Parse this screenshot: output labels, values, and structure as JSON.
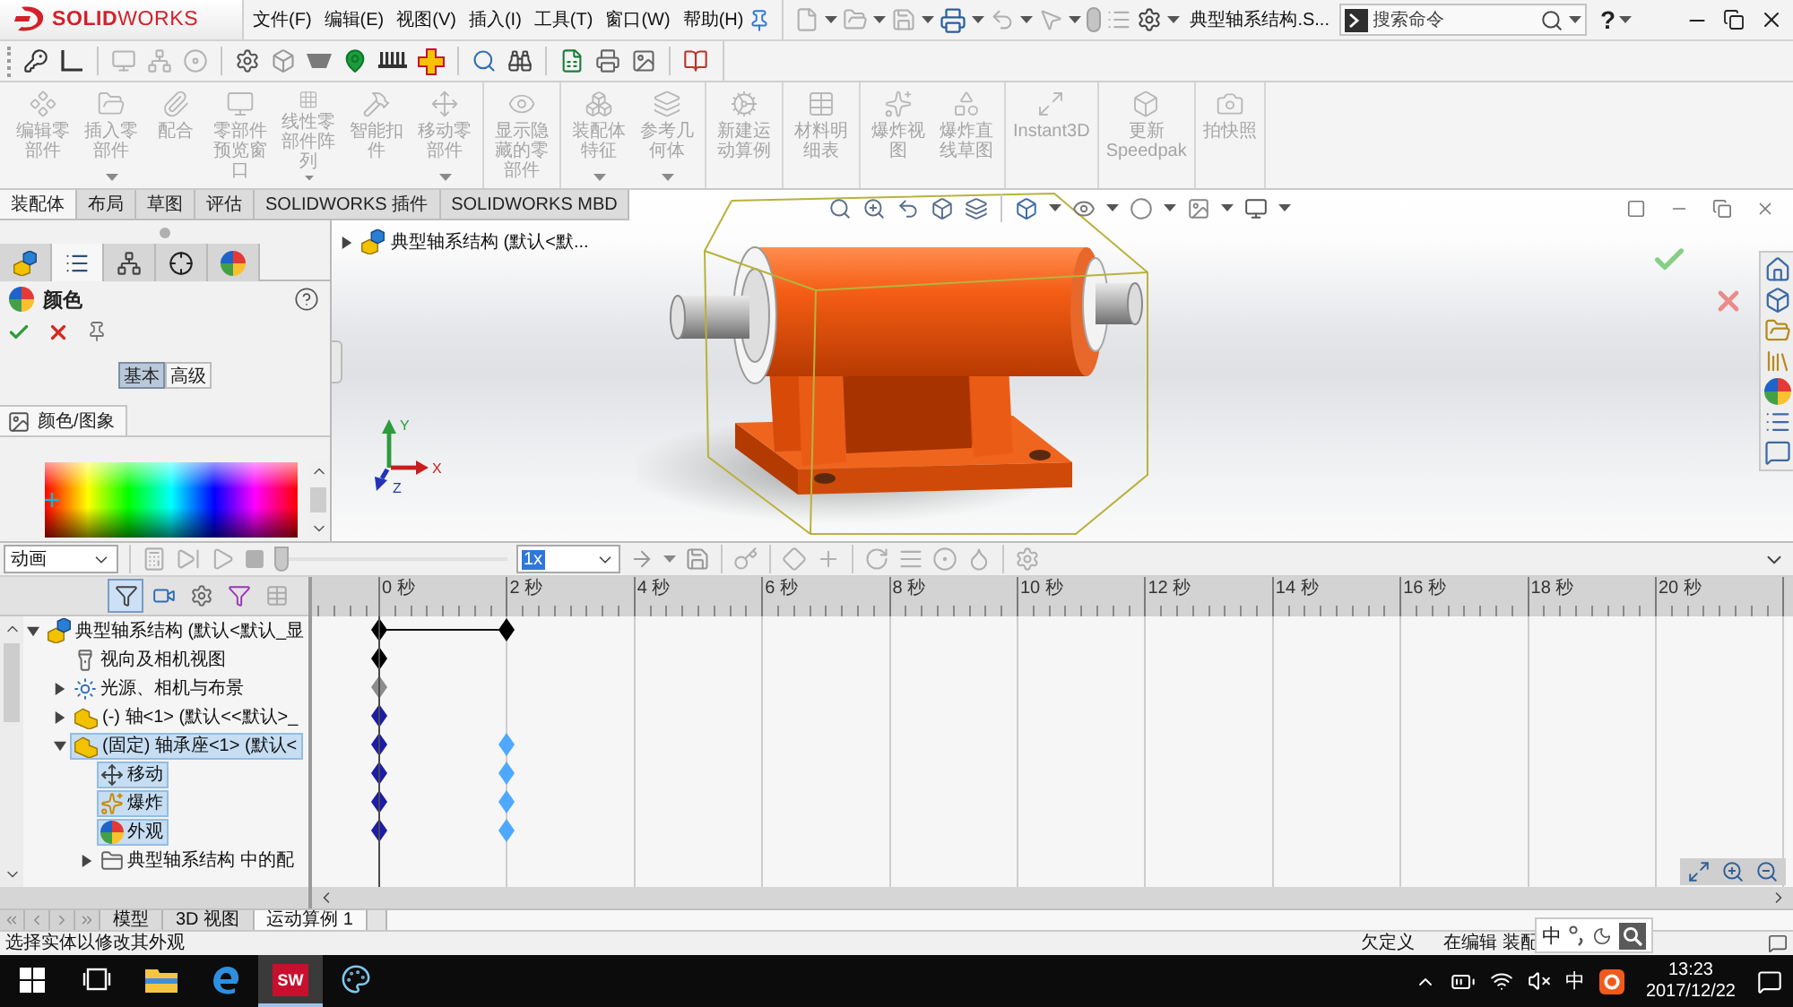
{
  "menubar": {
    "logo": "**SOLID**WORKS",
    "menus": [
      "文件(F)",
      "编辑(E)",
      "视图(V)",
      "插入(I)",
      "工具(T)",
      "窗口(W)",
      "帮助(H)"
    ],
    "document_title": "典型轴系结构.S...",
    "search": {
      "placeholder": "搜索命令"
    },
    "help": "?"
  },
  "ribbon": {
    "groups": [
      [
        {
          "label": "编辑零部件",
          "disabled": true,
          "dropdown": false
        },
        {
          "label": "插入零部件",
          "disabled": true,
          "dropdown": true
        },
        {
          "label": "配合",
          "disabled": true,
          "dropdown": false
        },
        {
          "label": "零部件预览窗口",
          "disabled": true,
          "dropdown": false
        },
        {
          "label": "线性零部件阵列",
          "disabled": true,
          "dropdown": true
        },
        {
          "label": "智能扣件",
          "disabled": true,
          "dropdown": false
        },
        {
          "label": "移动零部件",
          "disabled": true,
          "dropdown": true
        }
      ],
      [
        {
          "label": "显示隐藏的零部件",
          "disabled": true,
          "dropdown": false
        }
      ],
      [
        {
          "label": "装配体特征",
          "disabled": true,
          "dropdown": true
        },
        {
          "label": "参考几何体",
          "disabled": true,
          "dropdown": true
        }
      ],
      [
        {
          "label": "新建运动算例",
          "disabled": true,
          "dropdown": false
        }
      ],
      [
        {
          "label": "材料明细表",
          "disabled": true,
          "dropdown": false
        }
      ],
      [
        {
          "label": "爆炸视图",
          "disabled": true,
          "dropdown": false
        },
        {
          "label": "爆炸直线草图",
          "disabled": true,
          "dropdown": false
        }
      ],
      [
        {
          "label": "Instant3D",
          "disabled": true,
          "dropdown": false
        }
      ],
      [
        {
          "label": "更新 Speedpak",
          "disabled": true,
          "dropdown": false
        }
      ],
      [
        {
          "label": "拍快照",
          "disabled": true,
          "dropdown": false
        }
      ]
    ]
  },
  "tabs": [
    {
      "label": "装配体",
      "selected": true
    },
    {
      "label": "布局",
      "selected": false
    },
    {
      "label": "草图",
      "selected": false
    },
    {
      "label": "评估",
      "selected": false
    },
    {
      "label": "SOLIDWORKS 插件",
      "selected": false
    },
    {
      "label": "SOLIDWORKS MBD",
      "selected": false
    }
  ],
  "property_manager": {
    "tabs": [
      {
        "kind": "feature-tree",
        "selected": false
      },
      {
        "kind": "properties",
        "selected": true
      },
      {
        "kind": "configurations",
        "selected": false
      },
      {
        "kind": "dimxpert",
        "selected": false
      },
      {
        "kind": "display",
        "selected": false
      }
    ],
    "title": "颜色",
    "modes": [
      {
        "label": "基本",
        "selected": true
      },
      {
        "label": "高级",
        "selected": false
      }
    ],
    "section": "颜色/图象"
  },
  "viewport": {
    "tree_flyout": {
      "label": "典型轴系结构 (默认<默...",
      "expanded": false
    },
    "triad": [
      "X",
      "Y",
      "Z"
    ]
  },
  "motion_study": {
    "mode": "动画",
    "playback": {
      "level": 0
    },
    "speed": {
      "value": "1x",
      "highlighted": true
    },
    "filters": [
      {
        "kind": "funnel",
        "on": true
      },
      {
        "kind": "camera",
        "on": false
      },
      {
        "kind": "gear",
        "on": false
      },
      {
        "kind": "pointer",
        "on": false
      },
      {
        "kind": "table",
        "on": false
      }
    ],
    "tree": [
      {
        "kind": "assembly",
        "label": "典型轴系结构 (默认<默认_显",
        "expanded": true,
        "selected": false,
        "span": true,
        "start_key": {
          "color": "#000000"
        },
        "end_key": {
          "color": "#000000"
        },
        "children": [
          {
            "kind": "camera",
            "label": "视向及相机视图",
            "selected": false,
            "start_key": {
              "color": "#000000"
            }
          },
          {
            "kind": "lights",
            "label": "光源、相机与布景",
            "expanded": false,
            "selected": false,
            "start_key": {
              "color": "#8c8c8c"
            }
          },
          {
            "kind": "part",
            "label": "(-) 轴<1> (默认<<默认>_",
            "expanded": false,
            "selected": false,
            "start_key": {
              "color": "#1c1ca8"
            }
          },
          {
            "kind": "part",
            "label": "(固定) 轴承座<1> (默认<",
            "expanded": true,
            "selected": true,
            "span": false,
            "start_key": {
              "color": "#1c1ca8"
            },
            "end_key": {
              "color": "#4ea8ff"
            },
            "children": [
              {
                "kind": "move",
                "label": "移动",
                "selected": true,
                "span": false,
                "start_key": {
                  "color": "#1c1ca8"
                },
                "end_key": {
                  "color": "#4ea8ff"
                }
              },
              {
                "kind": "explode",
                "label": "爆炸",
                "selected": true,
                "span": false,
                "start_key": {
                  "color": "#1c1ca8"
                },
                "end_key": {
                  "color": "#4ea8ff"
                }
              },
              {
                "kind": "appearance",
                "label": "外观",
                "selected": true,
                "span": false,
                "start_key": {
                  "color": "#1c1ca8"
                },
                "end_key": {
                  "color": "#4ea8ff"
                }
              },
              {
                "kind": "mates",
                "label": "典型轴系结构 中的配",
                "expanded": false,
                "selected": false
              }
            ]
          }
        ]
      }
    ],
    "ruler": [
      "0 秒",
      "2 秒",
      "4 秒",
      "6 秒",
      "8 秒",
      "10 秒",
      "12 秒",
      "14 秒",
      "16 秒",
      "18 秒",
      "20 秒"
    ],
    "playhead": {
      "level": 0
    }
  },
  "bottom_tabs": [
    {
      "label": "模型",
      "selected": false
    },
    {
      "label": "3D 视图",
      "selected": false
    },
    {
      "label": "运动算例 1",
      "selected": true
    }
  ],
  "status_bar": {
    "message": "选择实体以修改其外观",
    "state": "欠定义",
    "mode": "在编辑 装配"
  },
  "ime_bar": {
    "mode": "中"
  },
  "taskbar": {
    "apps": [
      {
        "kind": "explorer",
        "active": false
      },
      {
        "kind": "edge",
        "active": false
      },
      {
        "kind": "solidworks",
        "label": "SW",
        "active": true
      },
      {
        "kind": "paint",
        "active": false
      }
    ],
    "tray": {
      "ime": "中",
      "time": "13:23",
      "date": "2017/12/22"
    }
  }
}
